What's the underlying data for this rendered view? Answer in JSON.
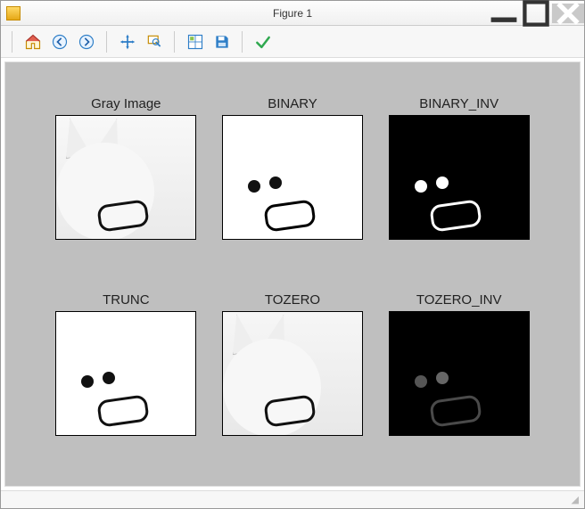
{
  "window": {
    "title": "Figure 1"
  },
  "toolbar": {
    "icons": {
      "home": "home-icon",
      "back": "back-icon",
      "forward": "forward-icon",
      "pan": "pan-icon",
      "zoom": "zoom-icon",
      "subplots": "subplots-icon",
      "save": "save-icon",
      "customize": "customize-icon"
    }
  },
  "chart_data": [
    {
      "type": "table",
      "title": "Gray Image"
    },
    {
      "type": "table",
      "title": "BINARY"
    },
    {
      "type": "table",
      "title": "BINARY_INV"
    },
    {
      "type": "table",
      "title": "TRUNC"
    },
    {
      "type": "table",
      "title": "TOZERO"
    },
    {
      "type": "table",
      "title": "TOZERO_INV"
    }
  ]
}
